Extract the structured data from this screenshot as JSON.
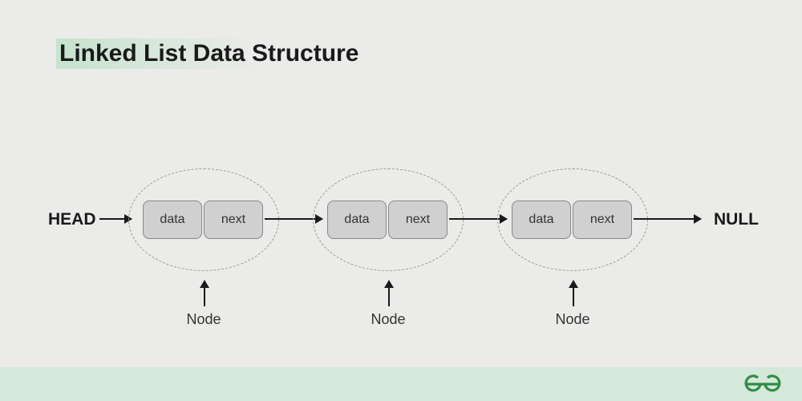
{
  "title": "Linked List Data Structure",
  "head_label": "HEAD",
  "null_label": "NULL",
  "nodes": [
    {
      "data_label": "data",
      "next_label": "next",
      "caption": "Node"
    },
    {
      "data_label": "data",
      "next_label": "next",
      "caption": "Node"
    },
    {
      "data_label": "data",
      "next_label": "next",
      "caption": "Node"
    }
  ],
  "colors": {
    "background": "#ebebe9",
    "footer": "#d5e8da",
    "cell_fill": "#d0d0d0",
    "logo_green": "#2f8d46"
  }
}
